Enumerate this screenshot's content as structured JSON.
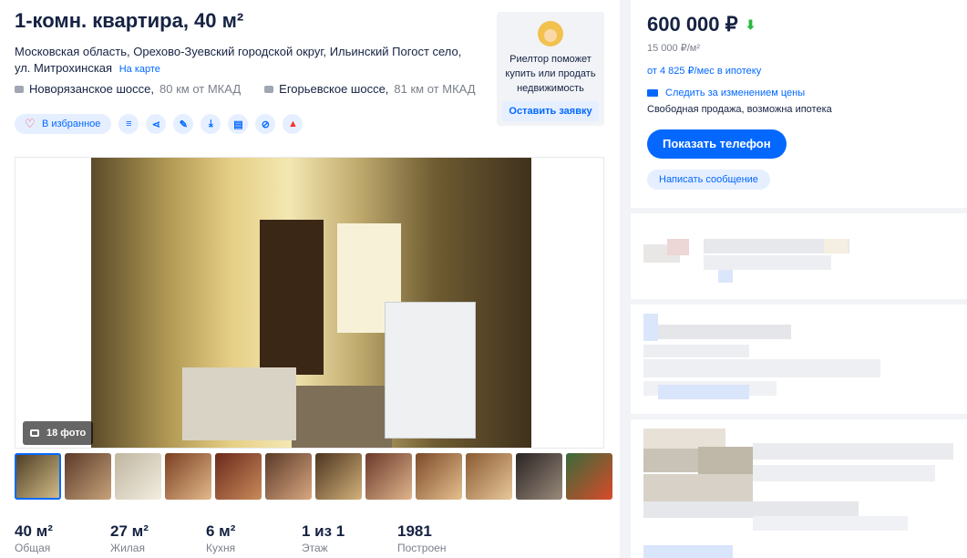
{
  "listing": {
    "title": "1-комн. квартира, 40 м²",
    "address": "Московская область, Орехово-Зуевский городской округ, Ильинский Погост село, ул. Митрохинская",
    "map_link": "На карте",
    "routes": [
      {
        "highway": "Новорязанское шоссе,",
        "distance": "80 км от МКАД"
      },
      {
        "highway": "Егорьевское шоссе,",
        "distance": "81 км от МКАД"
      }
    ]
  },
  "realtor_promo": {
    "text": "Риелтор поможет купить или продать недвижимость",
    "button": "Оставить заявку"
  },
  "actions": {
    "favorite_label": "В избранное"
  },
  "gallery": {
    "photo_count": "18 фото"
  },
  "stats": [
    {
      "value": "40 м²",
      "label": "Общая"
    },
    {
      "value": "27 м²",
      "label": "Жилая"
    },
    {
      "value": "6 м²",
      "label": "Кухня"
    },
    {
      "value": "1 из 1",
      "label": "Этаж"
    },
    {
      "value": "1981",
      "label": "Построен"
    }
  ],
  "price_card": {
    "price": "600 000 ₽",
    "price_per_m2": "15 000 ₽/м²",
    "mortgage": "от 4 825 ₽/мес в ипотеку",
    "watch_price": "Следить за изменением цены",
    "sale_terms": "Свободная продажа, возможна ипотека",
    "phone_button": "Показать телефон",
    "message_button": "Написать сообщение"
  },
  "colors": {
    "accent": "#0468ff",
    "accent_light": "#e5efff",
    "price_down": "#2bb741",
    "text": "#152242",
    "muted": "#7a7f8a"
  }
}
